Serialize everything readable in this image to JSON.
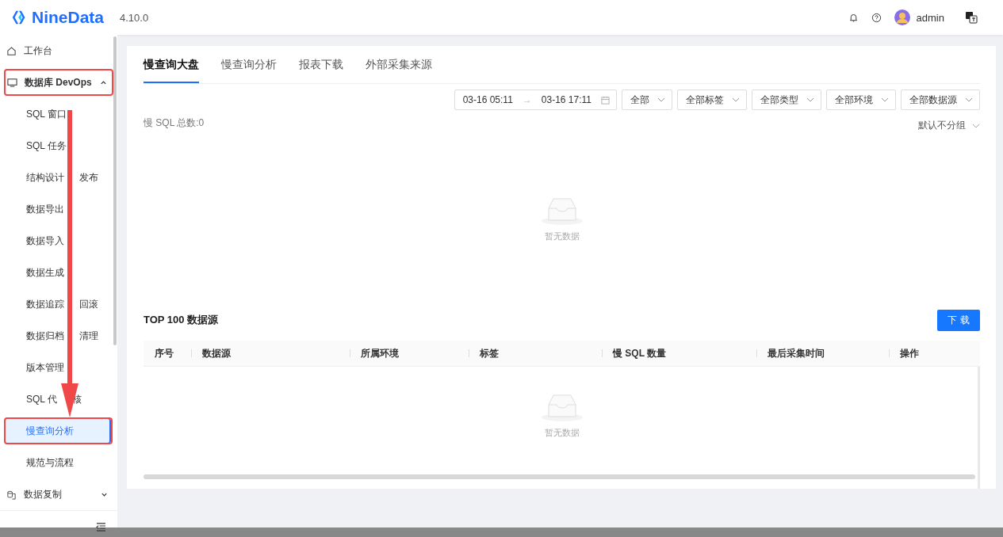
{
  "header": {
    "brand": "NineData",
    "version": "4.10.0",
    "user": "admin"
  },
  "sidebar": {
    "items": [
      {
        "label": "工作台",
        "selected": false
      },
      {
        "label": "数据库 DevOps",
        "selected": false,
        "expanded": true,
        "highlighted": true,
        "children": [
          {
            "label": [
              "SQL 窗口"
            ],
            "selected": false
          },
          {
            "label": [
              "SQL 任务"
            ],
            "selected": false
          },
          {
            "label": [
              "结构设计",
              "发布"
            ],
            "selected": false
          },
          {
            "label": [
              "数据导出"
            ],
            "selected": false
          },
          {
            "label": [
              "数据导入"
            ],
            "selected": false
          },
          {
            "label": [
              "数据生成"
            ],
            "selected": false
          },
          {
            "label": [
              "数据追踪",
              "回滚"
            ],
            "selected": false
          },
          {
            "label": [
              "数据归档",
              "清理"
            ],
            "selected": false
          },
          {
            "label": [
              "版本管理"
            ],
            "selected": false
          },
          {
            "label": [
              "SQL 代",
              "核"
            ],
            "selected": false
          },
          {
            "label": [
              "慢查询分析"
            ],
            "selected": true,
            "highlighted": true
          },
          {
            "label": [
              "规范与流程"
            ],
            "selected": false
          }
        ]
      },
      {
        "label": "数据复制",
        "selected": false,
        "expanded": false
      }
    ]
  },
  "tabs": [
    {
      "label": "慢查询大盘",
      "selected": true
    },
    {
      "label": "慢查询分析",
      "selected": false
    },
    {
      "label": "报表下载",
      "selected": false
    },
    {
      "label": "外部采集来源",
      "selected": false
    }
  ],
  "filters": {
    "date_start": "03-16 05:11",
    "date_separator": "→",
    "date_end": "03-16 17:11",
    "selects": [
      "全部",
      "全部标签",
      "全部类型",
      "全部环境",
      "全部数据源"
    ]
  },
  "summary": "慢 SQL 总数:0",
  "grouping": "默认不分组",
  "chart_empty": "暂无数据",
  "table": {
    "title": "TOP 100 数据源",
    "download": "下 载",
    "columns": [
      "序号",
      "数据源",
      "所属环境",
      "标签",
      "慢 SQL 数量",
      "最后采集时间",
      "操作"
    ],
    "empty": "暂无数据"
  }
}
